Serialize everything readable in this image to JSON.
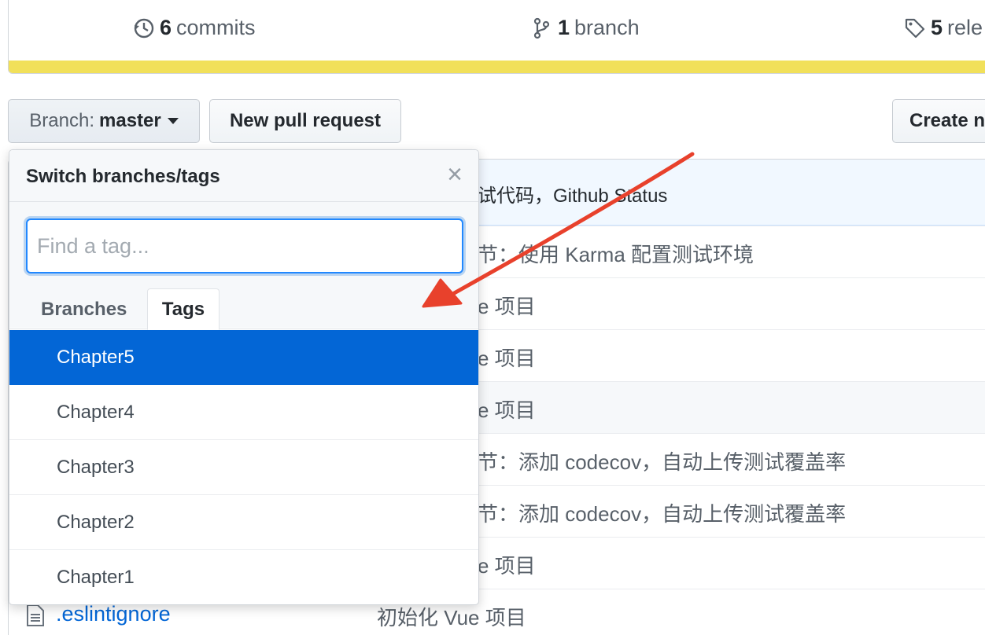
{
  "stats": {
    "commits_count": "6",
    "commits_label": "commits",
    "branch_count": "1",
    "branch_label": "branch",
    "releases_count": "5",
    "releases_label": "rele"
  },
  "toolbar": {
    "branch_prefix": "Branch:",
    "branch_value": "master",
    "new_pr": "New pull request",
    "create": "Create n"
  },
  "commit_bar": {
    "message": "试代码，Github Status"
  },
  "file_rows": [
    {
      "message": "节：使用 Karma 配置测试环境"
    },
    {
      "message": "e 项目"
    },
    {
      "message": "e 项目"
    },
    {
      "message": "e 项目"
    },
    {
      "message": "节：添加 codecov，自动上传测试覆盖率"
    },
    {
      "message": "节：添加 codecov，自动上传测试覆盖率"
    },
    {
      "message": "e 项目"
    }
  ],
  "last_file": {
    "name": ".eslintignore",
    "message": "初始化 Vue 项目"
  },
  "dropdown": {
    "title": "Switch branches/tags",
    "close": "×",
    "filter_placeholder": "Find a tag...",
    "tabs": {
      "branches": "Branches",
      "tags": "Tags"
    },
    "items": [
      "Chapter5",
      "Chapter4",
      "Chapter3",
      "Chapter2",
      "Chapter1"
    ],
    "selected": "Chapter5"
  },
  "colors": {
    "accent": "#0366d6",
    "language_bar": "#f1e05a",
    "annotation_arrow": "#e8412c"
  }
}
